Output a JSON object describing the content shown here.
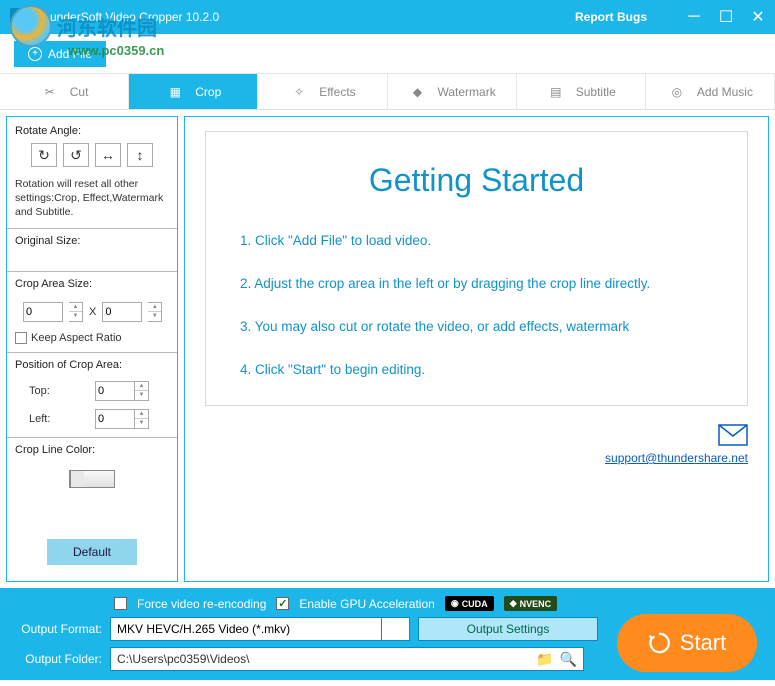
{
  "titlebar": {
    "title": "ThunderSoft Video Cropper 10.2.0",
    "report_bugs": "Report Bugs"
  },
  "watermark": {
    "cn_text": "河东软件园",
    "url": "www.pc0359.cn"
  },
  "toolbar": {
    "add_file": "Add File"
  },
  "tabs": {
    "cut": "Cut",
    "crop": "Crop",
    "effects": "Effects",
    "watermark": "Watermark",
    "subtitle": "Subtitle",
    "add_music": "Add Music"
  },
  "side": {
    "rotate_angle": "Rotate Angle:",
    "rotate_note": "Rotation will reset all other settings:Crop, Effect,Watermark and Subtitle.",
    "original_size": "Original Size:",
    "crop_area_size": "Crop Area Size:",
    "width": "0",
    "x": "X",
    "height": "0",
    "keep_aspect": "Keep Aspect Ratio",
    "pos_label": "Position of Crop Area:",
    "top": "Top:",
    "top_val": "0",
    "left": "Left:",
    "left_val": "0",
    "crop_line_color": "Crop Line Color:",
    "default_btn": "Default"
  },
  "getting_started": {
    "title": "Getting Started",
    "step1": "1. Click \"Add File\" to load video.",
    "step2": "2. Adjust the crop area in the left or by dragging the crop line directly.",
    "step3": "3. You may also cut or rotate the video, or add effects, watermark",
    "step4": "4. Click \"Start\" to begin editing.",
    "support_link": "support@thundershare.net"
  },
  "bottom": {
    "force_reencode": "Force video re-encoding",
    "gpu_accel": "Enable GPU Acceleration",
    "cuda": "CUDA",
    "nvenc": "NVENC",
    "output_format_label": "Output Format:",
    "output_format_value": "MKV HEVC/H.265 Video (*.mkv)",
    "output_settings": "Output Settings",
    "output_folder_label": "Output Folder:",
    "output_folder_value": "C:\\Users\\pc0359\\Videos\\",
    "start": "Start"
  }
}
